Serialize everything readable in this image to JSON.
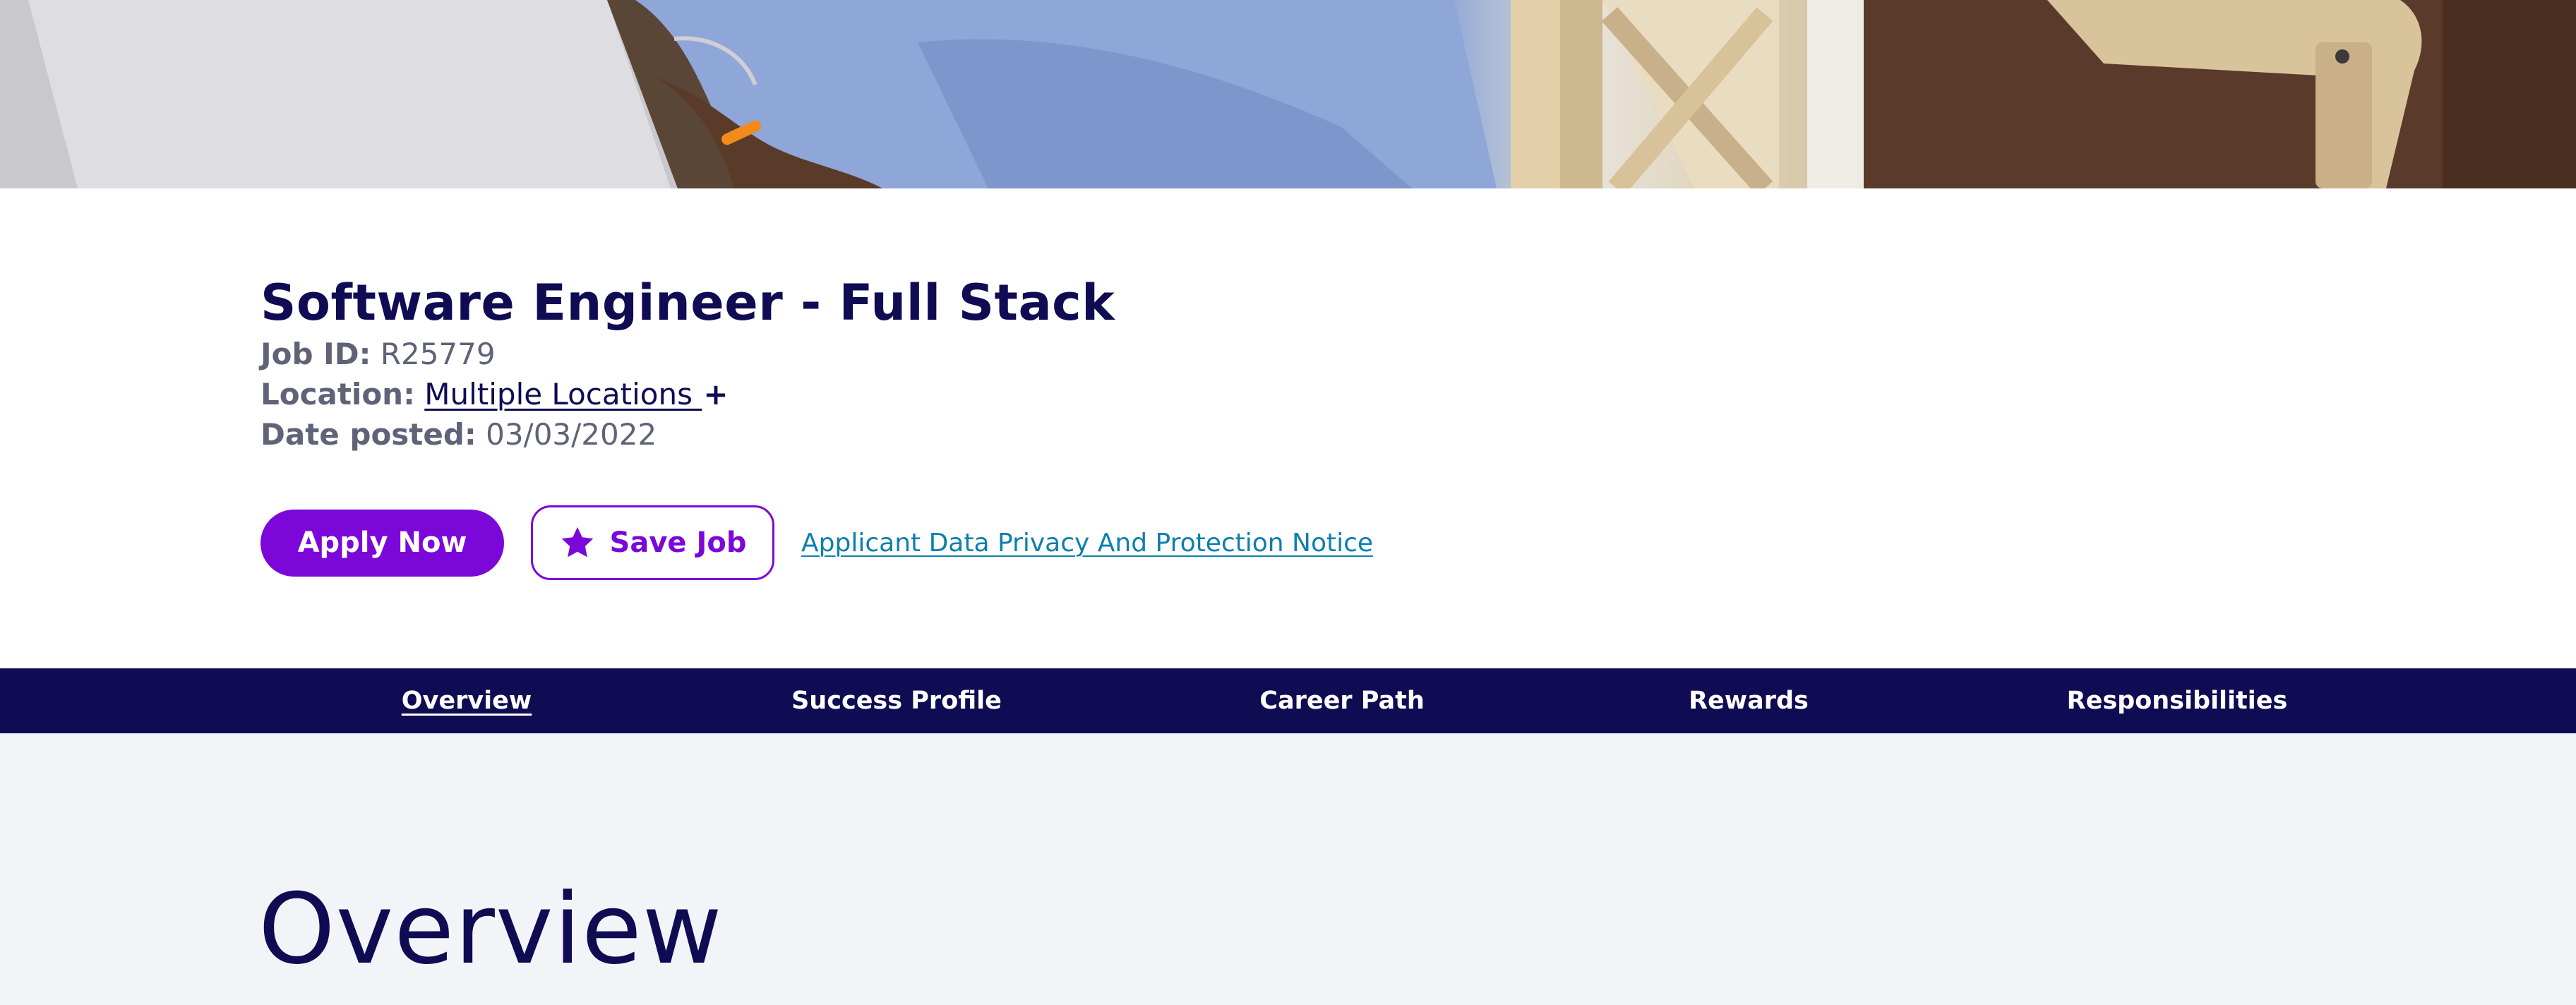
{
  "job": {
    "title": "Software Engineer - Full Stack",
    "job_id_label": "Job ID:",
    "job_id": "R25779",
    "location_label": "Location:",
    "location_value": "Multiple Locations ",
    "location_more": "+",
    "date_label": "Date posted:",
    "date_value": "03/03/2022"
  },
  "actions": {
    "apply_label": "Apply Now",
    "save_label": "Save Job",
    "save_icon": "star-icon",
    "privacy_link": "Applicant Data Privacy And Protection Notice"
  },
  "tabs": [
    {
      "label": "Overview",
      "active": true
    },
    {
      "label": "Success Profile",
      "active": false
    },
    {
      "label": "Career Path",
      "active": false
    },
    {
      "label": "Rewards",
      "active": false
    },
    {
      "label": "Responsibilities",
      "active": false
    }
  ],
  "content": {
    "section_title": "Overview"
  },
  "colors": {
    "navy": "#0f0c54",
    "purple": "#7b08d8",
    "link_blue": "#0d7fae",
    "meta_gray": "#5f6378",
    "content_bg": "#f3f4f8"
  }
}
